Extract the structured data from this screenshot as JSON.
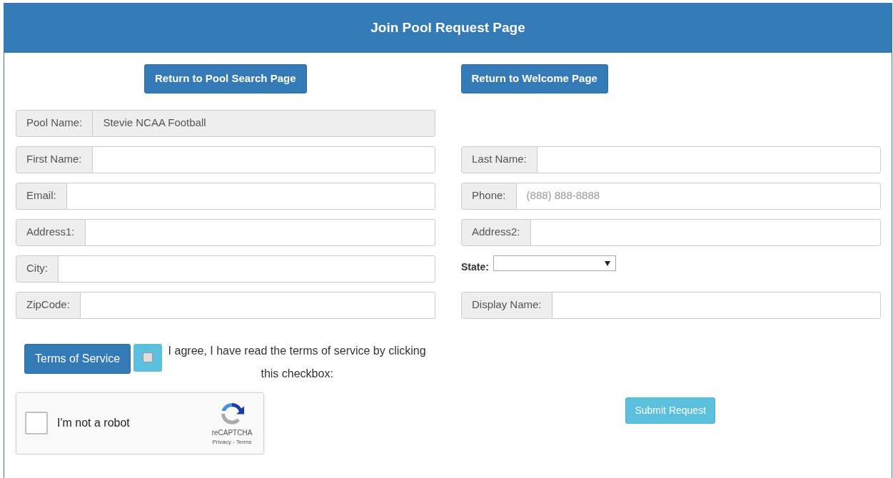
{
  "header": {
    "title": "Join Pool Request Page"
  },
  "nav_buttons": [
    "Return to Pool Search Page",
    "Return to Welcome Page"
  ],
  "left_fields": [
    {
      "kind": "input",
      "label": "Pool Name:",
      "value": "Stevie NCAA Football",
      "readonly": true
    },
    {
      "kind": "input",
      "label": "First Name:",
      "readonly": false
    },
    {
      "kind": "input",
      "label": "Email:",
      "readonly": false
    },
    {
      "kind": "input",
      "label": "Address1:",
      "readonly": false
    },
    {
      "kind": "input",
      "label": "City:",
      "readonly": false
    },
    {
      "kind": "input",
      "label": "ZipCode:",
      "readonly": false
    }
  ],
  "right_fields": [
    {
      "kind": "input",
      "label": "Last Name:",
      "readonly": false
    },
    {
      "kind": "input",
      "label": "Phone:",
      "placeholder": "(888) 888-8888",
      "readonly": false
    },
    {
      "kind": "input",
      "label": "Address2:",
      "readonly": false
    },
    {
      "kind": "select",
      "label": "State:"
    },
    {
      "kind": "input",
      "label": "Display Name:",
      "readonly": false
    }
  ],
  "terms": {
    "button": "Terms of Service",
    "checked": false,
    "text": "I agree, I have read the terms of service by clicking this checkbox:"
  },
  "captcha": {
    "checked": false,
    "label": "I'm not a robot",
    "brand": "reCAPTCHA",
    "links": "Privacy - Terms"
  },
  "submit": "Submit Request"
}
